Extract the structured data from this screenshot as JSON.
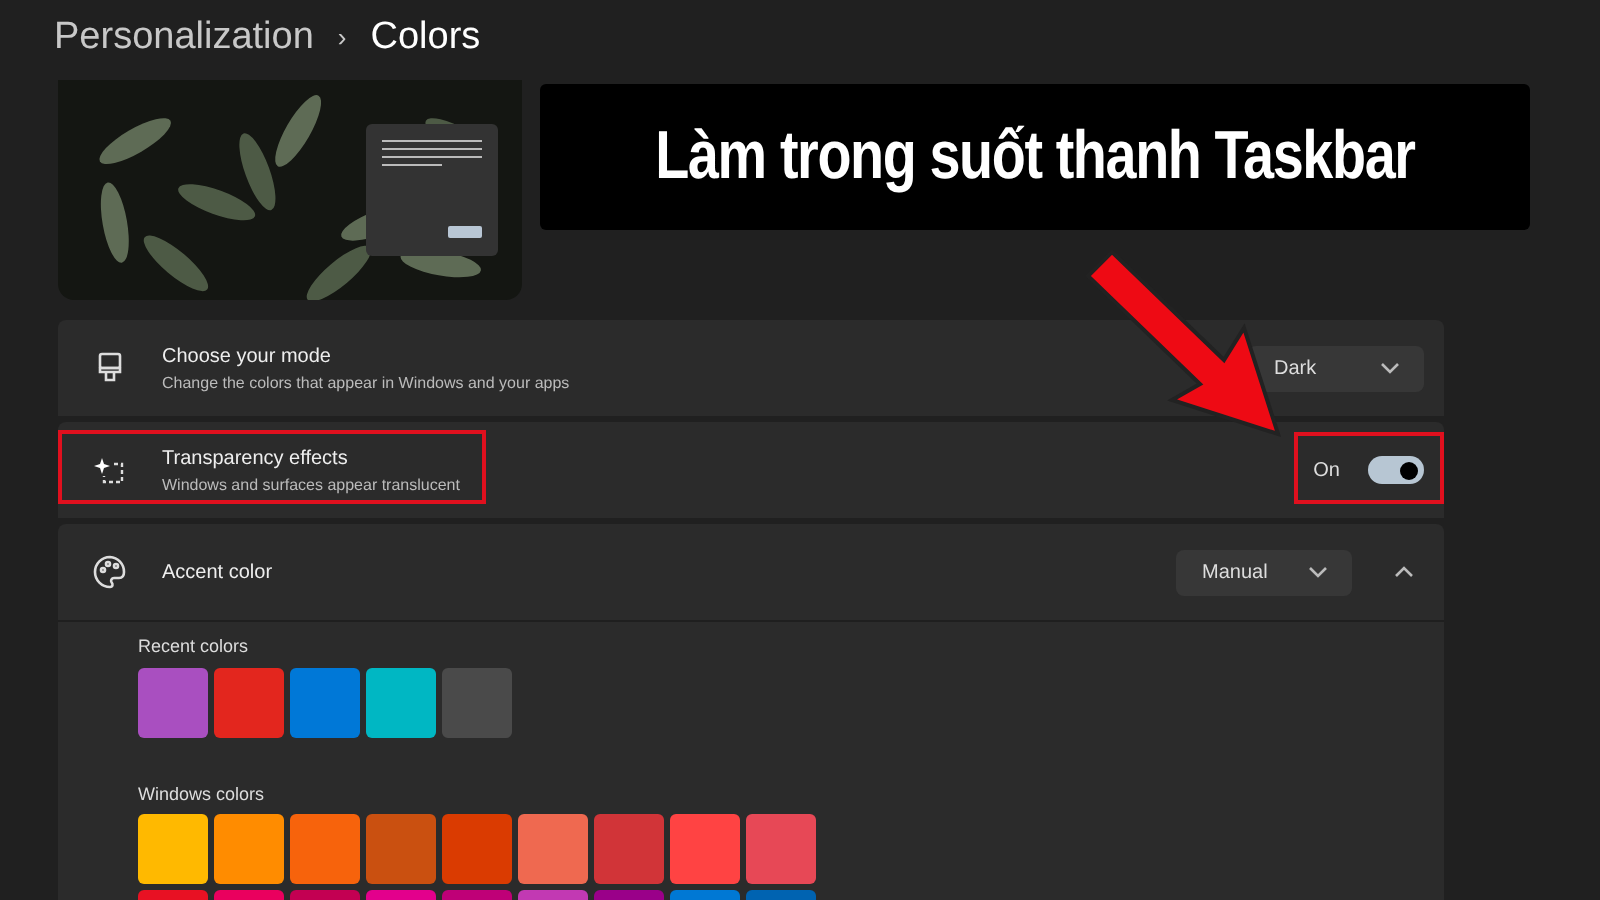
{
  "breadcrumb": {
    "parent": "Personalization",
    "separator": "›",
    "current": "Colors"
  },
  "banner": {
    "text": "Làm trong suốt thanh Taskbar"
  },
  "settings": [
    {
      "kind": "dropdown",
      "title": "Choose your mode",
      "subtitle": "Change the colors that appear in Windows and your apps",
      "value": "Dark",
      "highlighted": false
    },
    {
      "kind": "toggle",
      "title": "Transparency effects",
      "subtitle": "Windows and surfaces appear translucent",
      "value": "On",
      "on": true,
      "highlighted": true
    },
    {
      "kind": "dropdown",
      "title": "Accent color",
      "value": "Manual",
      "expanded": true,
      "highlighted": false
    }
  ],
  "recent_colors": {
    "label": "Recent colors",
    "swatches": [
      {
        "color": "#a94fc0"
      },
      {
        "color": "#e3261e"
      },
      {
        "color": "#0078d7"
      },
      {
        "color": "#00b7c3"
      },
      {
        "color": "#4a4a4a"
      }
    ]
  },
  "windows_colors": {
    "label": "Windows colors",
    "swatches": [
      {
        "color": "#ffb900"
      },
      {
        "color": "#ff8c00"
      },
      {
        "color": "#f7630c"
      },
      {
        "color": "#ca5010"
      },
      {
        "color": "#da3b01"
      },
      {
        "color": "#ef6950"
      },
      {
        "color": "#d13438"
      },
      {
        "color": "#ff4343"
      },
      {
        "color": "#e74856"
      },
      {
        "color": "#e81123"
      },
      {
        "color": "#ea005e"
      },
      {
        "color": "#c30052"
      },
      {
        "color": "#e3008c"
      },
      {
        "color": "#bf0077"
      },
      {
        "color": "#c239b3"
      },
      {
        "color": "#9a0089"
      },
      {
        "color": "#0078d4"
      },
      {
        "color": "#0063b1"
      }
    ]
  }
}
